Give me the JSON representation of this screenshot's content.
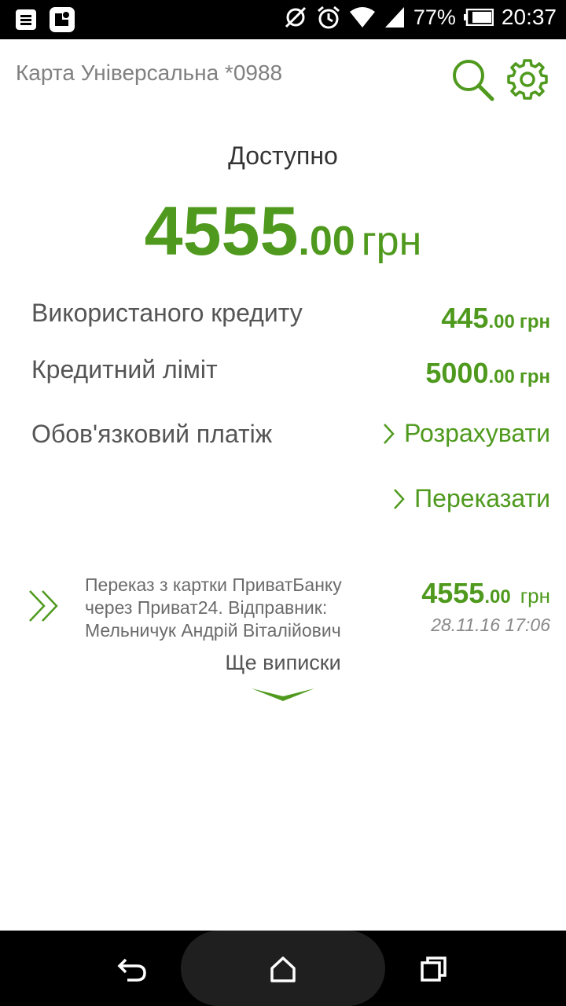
{
  "status_bar": {
    "battery": "77%",
    "time": "20:37"
  },
  "header": {
    "title": "Карта Універсальна *0988",
    "icons": [
      "search-icon",
      "gear-icon"
    ]
  },
  "balance": {
    "label": "Доступно",
    "int": "4555",
    "frac": ".00",
    "currency": "грн"
  },
  "details": [
    {
      "label": "Використаного кредиту",
      "int": "445",
      "frac": ".00",
      "currency": "грн"
    },
    {
      "label": "Кредитний ліміт",
      "int": "5000",
      "frac": ".00",
      "currency": "грн"
    },
    {
      "label": "Обов'язковий платіж"
    }
  ],
  "links": {
    "calculate": "Розрахувати",
    "transfer": "Переказати"
  },
  "transaction": {
    "description": "Переказ з картки ПриватБанку через Приват24. Відправник: Мельничук Андрій Віталійович",
    "int": "4555",
    "frac": ".00",
    "currency": "грн",
    "date": "28.11.16 17:06"
  },
  "more": {
    "label": "Ще виписки"
  },
  "colors": {
    "accent": "#4f9a1e",
    "status_bar": "#000000"
  }
}
